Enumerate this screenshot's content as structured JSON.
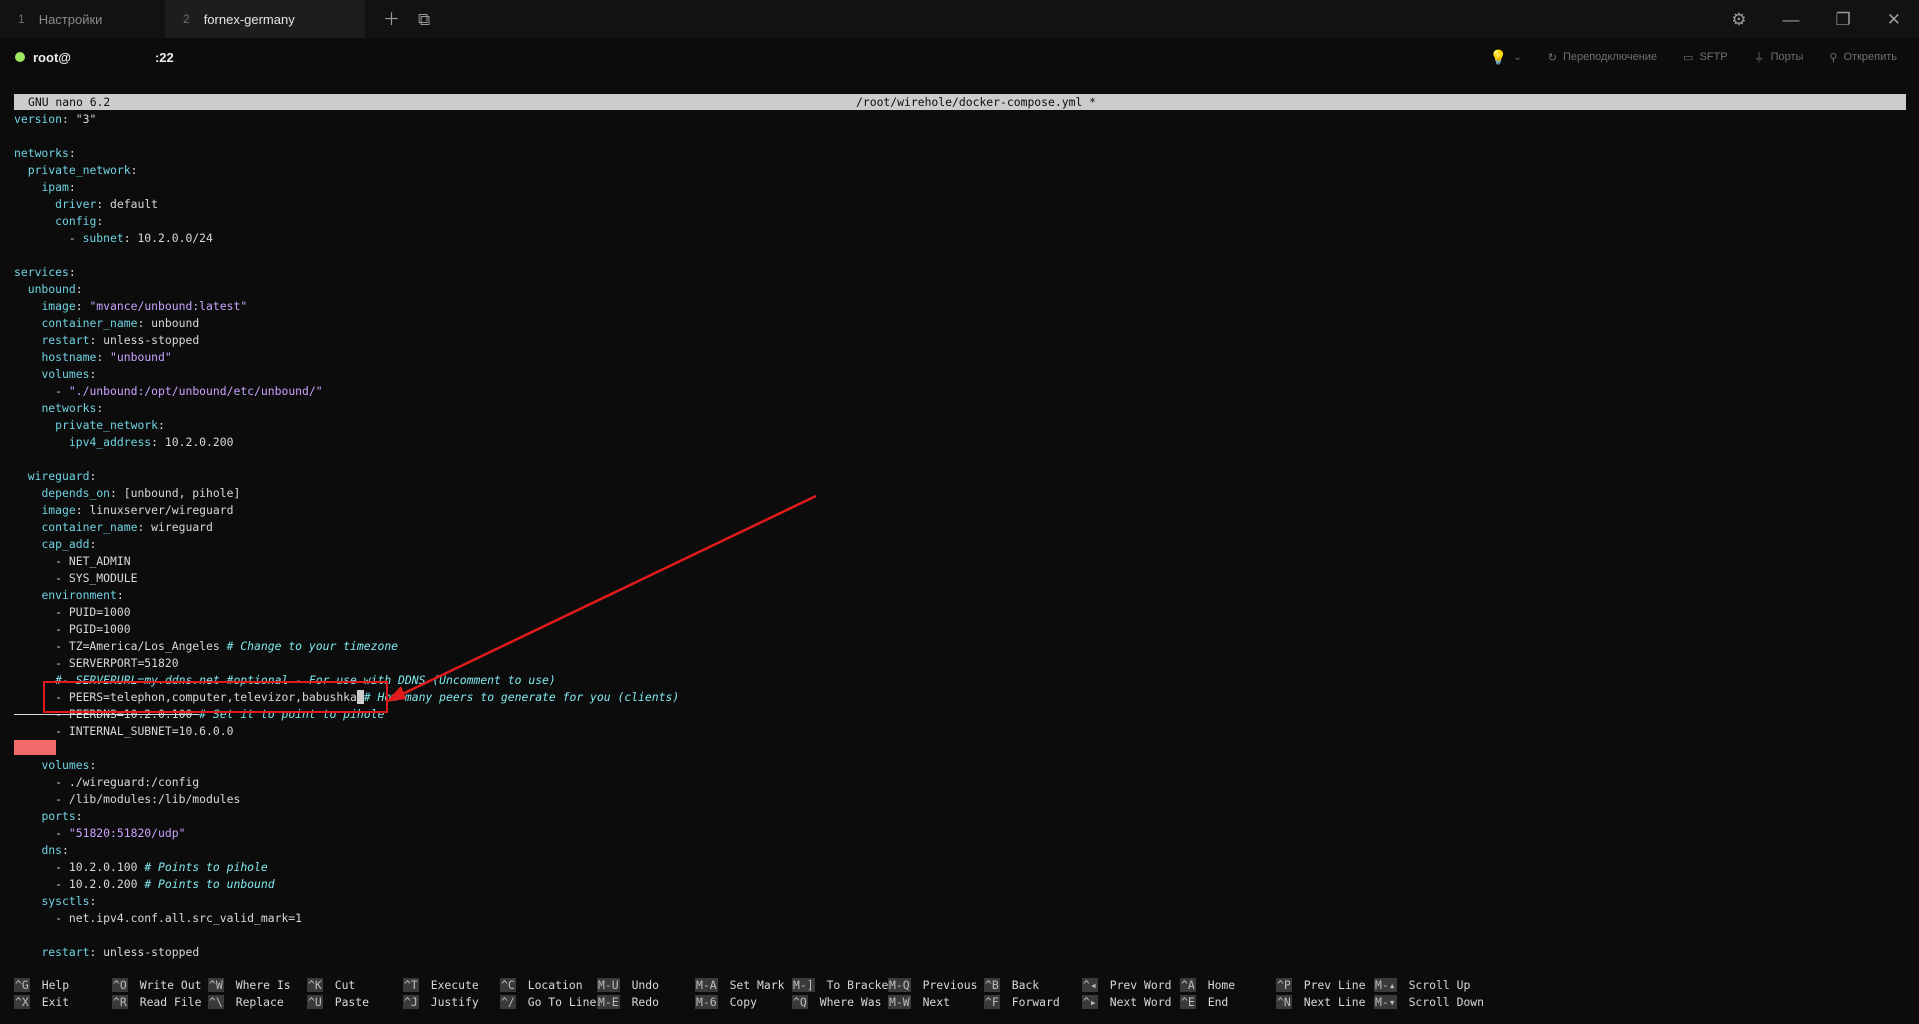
{
  "tabs": [
    {
      "num": "1",
      "label": "Настройки"
    },
    {
      "num": "2",
      "label": "fornex-germany"
    }
  ],
  "tab_actions": {
    "add_icon": "plus-icon",
    "window_icon": "copy-window-icon"
  },
  "window_controls": {
    "settings": "gear-icon",
    "minimize": "minimize-icon",
    "restore": "restore-icon",
    "close": "close-icon"
  },
  "session": {
    "user": "root@",
    "port": ":22",
    "status_color": "#9ee85f",
    "actions": [
      {
        "icon": "reconnect-icon",
        "label": "Переподключение"
      },
      {
        "icon": "sftp-icon",
        "label": "SFTP"
      },
      {
        "icon": "ports-icon",
        "label": "Порты"
      },
      {
        "icon": "pin-icon",
        "label": "Открепить"
      }
    ]
  },
  "editor": {
    "version": "GNU nano 6.2",
    "file": "/root/wirehole/docker-compose.yml *"
  },
  "annotation": {
    "color": "#e11b1b"
  },
  "lines": [
    [
      {
        "t": "k",
        "v": "version"
      },
      {
        "t": "v",
        "v": ": \"3\""
      }
    ],
    [],
    [
      {
        "t": "k",
        "v": "networks"
      },
      {
        "t": "v",
        "v": ":"
      }
    ],
    [
      {
        "t": "v",
        "v": "  "
      },
      {
        "t": "k",
        "v": "private_network"
      },
      {
        "t": "v",
        "v": ":"
      }
    ],
    [
      {
        "t": "v",
        "v": "    "
      },
      {
        "t": "k",
        "v": "ipam"
      },
      {
        "t": "v",
        "v": ":"
      }
    ],
    [
      {
        "t": "v",
        "v": "      "
      },
      {
        "t": "k",
        "v": "driver"
      },
      {
        "t": "v",
        "v": ": default"
      }
    ],
    [
      {
        "t": "v",
        "v": "      "
      },
      {
        "t": "k",
        "v": "config"
      },
      {
        "t": "v",
        "v": ":"
      }
    ],
    [
      {
        "t": "v",
        "v": "        - "
      },
      {
        "t": "k",
        "v": "subnet"
      },
      {
        "t": "v",
        "v": ": 10.2.0.0/24"
      }
    ],
    [],
    [
      {
        "t": "k",
        "v": "services"
      },
      {
        "t": "v",
        "v": ":"
      }
    ],
    [
      {
        "t": "v",
        "v": "  "
      },
      {
        "t": "k",
        "v": "unbound"
      },
      {
        "t": "v",
        "v": ":"
      }
    ],
    [
      {
        "t": "v",
        "v": "    "
      },
      {
        "t": "k",
        "v": "image"
      },
      {
        "t": "v",
        "v": ": "
      },
      {
        "t": "s",
        "v": "\"mvance/unbound:latest\""
      }
    ],
    [
      {
        "t": "v",
        "v": "    "
      },
      {
        "t": "k",
        "v": "container_name"
      },
      {
        "t": "v",
        "v": ": unbound"
      }
    ],
    [
      {
        "t": "v",
        "v": "    "
      },
      {
        "t": "k",
        "v": "restart"
      },
      {
        "t": "v",
        "v": ": unless-stopped"
      }
    ],
    [
      {
        "t": "v",
        "v": "    "
      },
      {
        "t": "k",
        "v": "hostname"
      },
      {
        "t": "v",
        "v": ": "
      },
      {
        "t": "s",
        "v": "\"unbound\""
      }
    ],
    [
      {
        "t": "v",
        "v": "    "
      },
      {
        "t": "k",
        "v": "volumes"
      },
      {
        "t": "v",
        "v": ":"
      }
    ],
    [
      {
        "t": "v",
        "v": "      - "
      },
      {
        "t": "s",
        "v": "\"./unbound:/opt/unbound/etc/unbound/\""
      }
    ],
    [
      {
        "t": "v",
        "v": "    "
      },
      {
        "t": "k",
        "v": "networks"
      },
      {
        "t": "v",
        "v": ":"
      }
    ],
    [
      {
        "t": "v",
        "v": "      "
      },
      {
        "t": "k",
        "v": "private_network"
      },
      {
        "t": "v",
        "v": ":"
      }
    ],
    [
      {
        "t": "v",
        "v": "        "
      },
      {
        "t": "k",
        "v": "ipv4_address"
      },
      {
        "t": "v",
        "v": ": 10.2.0.200"
      }
    ],
    [],
    [
      {
        "t": "v",
        "v": "  "
      },
      {
        "t": "k",
        "v": "wireguard"
      },
      {
        "t": "v",
        "v": ":"
      }
    ],
    [
      {
        "t": "v",
        "v": "    "
      },
      {
        "t": "k",
        "v": "depends_on"
      },
      {
        "t": "v",
        "v": ": [unbound, pihole]"
      }
    ],
    [
      {
        "t": "v",
        "v": "    "
      },
      {
        "t": "k",
        "v": "image"
      },
      {
        "t": "v",
        "v": ": linuxserver/wireguard"
      }
    ],
    [
      {
        "t": "v",
        "v": "    "
      },
      {
        "t": "k",
        "v": "container_name"
      },
      {
        "t": "v",
        "v": ": wireguard"
      }
    ],
    [
      {
        "t": "v",
        "v": "    "
      },
      {
        "t": "k",
        "v": "cap_add"
      },
      {
        "t": "v",
        "v": ":"
      }
    ],
    [
      {
        "t": "v",
        "v": "      - NET_ADMIN"
      }
    ],
    [
      {
        "t": "v",
        "v": "      - SYS_MODULE"
      }
    ],
    [
      {
        "t": "v",
        "v": "    "
      },
      {
        "t": "k",
        "v": "environment"
      },
      {
        "t": "v",
        "v": ":"
      }
    ],
    [
      {
        "t": "v",
        "v": "      - PUID=1000"
      }
    ],
    [
      {
        "t": "v",
        "v": "      - PGID=1000"
      }
    ],
    [
      {
        "t": "v",
        "v": "      - TZ=America/Los_Angeles "
      },
      {
        "t": "c",
        "v": "# Change to your timezone"
      }
    ],
    [
      {
        "t": "v",
        "v": "      - SERVERPORT=51820"
      }
    ],
    [
      {
        "t": "c",
        "v": "      #- SERVERURL=my.ddns.net #optional - For use with DDNS (Uncomment to use)"
      }
    ],
    [
      {
        "t": "v",
        "v": "      - PEERS=telephon,computer,televizor,babushka"
      },
      {
        "t": "cur",
        "v": " "
      },
      {
        "t": "c",
        "v": "# How many peers to generate for you (clients)"
      }
    ],
    [
      {
        "t": "strike",
        "v": "      - PEERDNS=10.2.0.100 "
      },
      {
        "t": "c",
        "v": "# Set it to point to pihole"
      }
    ],
    [
      {
        "t": "v",
        "v": "      - INTERNAL_SUBNET=10.6.0.0"
      }
    ],
    [],
    [
      {
        "t": "v",
        "v": "    "
      },
      {
        "t": "k",
        "v": "volumes"
      },
      {
        "t": "v",
        "v": ":"
      }
    ],
    [
      {
        "t": "v",
        "v": "      - ./wireguard:/config"
      }
    ],
    [
      {
        "t": "v",
        "v": "      - /lib/modules:/lib/modules"
      }
    ],
    [
      {
        "t": "v",
        "v": "    "
      },
      {
        "t": "k",
        "v": "ports"
      },
      {
        "t": "v",
        "v": ":"
      }
    ],
    [
      {
        "t": "v",
        "v": "      - "
      },
      {
        "t": "s",
        "v": "\"51820:51820/udp\""
      }
    ],
    [
      {
        "t": "v",
        "v": "    "
      },
      {
        "t": "k",
        "v": "dns"
      },
      {
        "t": "v",
        "v": ":"
      }
    ],
    [
      {
        "t": "v",
        "v": "      - 10.2.0.100 "
      },
      {
        "t": "c",
        "v": "# Points to pihole"
      }
    ],
    [
      {
        "t": "v",
        "v": "      - 10.2.0.200 "
      },
      {
        "t": "c",
        "v": "# Points to unbound"
      }
    ],
    [
      {
        "t": "v",
        "v": "    "
      },
      {
        "t": "k",
        "v": "sysctls"
      },
      {
        "t": "v",
        "v": ":"
      }
    ],
    [
      {
        "t": "v",
        "v": "      - net.ipv4.conf.all.src_valid_mark=1"
      }
    ],
    [],
    [
      {
        "t": "v",
        "v": "    "
      },
      {
        "t": "k",
        "v": "restart"
      },
      {
        "t": "v",
        "v": ": unless-stopped"
      }
    ]
  ],
  "shortcuts": [
    [
      {
        "key": "^G",
        "label": "Help"
      },
      {
        "key": "^X",
        "label": "Exit"
      }
    ],
    [
      {
        "key": "^O",
        "label": "Write Out"
      },
      {
        "key": "^R",
        "label": "Read File"
      }
    ],
    [
      {
        "key": "^W",
        "label": "Where Is"
      },
      {
        "key": "^\\",
        "label": "Replace"
      }
    ],
    [
      {
        "key": "^K",
        "label": "Cut"
      },
      {
        "key": "^U",
        "label": "Paste"
      }
    ],
    [
      {
        "key": "^T",
        "label": "Execute"
      },
      {
        "key": "^J",
        "label": "Justify"
      }
    ],
    [
      {
        "key": "^C",
        "label": "Location"
      },
      {
        "key": "^/",
        "label": "Go To Line"
      }
    ],
    [
      {
        "key": "M-U",
        "label": "Undo"
      },
      {
        "key": "M-E",
        "label": "Redo"
      }
    ],
    [
      {
        "key": "M-A",
        "label": "Set Mark"
      },
      {
        "key": "M-6",
        "label": "Copy"
      }
    ],
    [
      {
        "key": "M-]",
        "label": "To Bracket"
      },
      {
        "key": "^Q",
        "label": "Where Was"
      }
    ],
    [
      {
        "key": "M-Q",
        "label": "Previous"
      },
      {
        "key": "M-W",
        "label": "Next"
      }
    ],
    [
      {
        "key": "^B",
        "label": "Back"
      },
      {
        "key": "^F",
        "label": "Forward"
      }
    ],
    [
      {
        "key": "^◂",
        "label": "Prev Word"
      },
      {
        "key": "^▸",
        "label": "Next Word"
      }
    ],
    [
      {
        "key": "^A",
        "label": "Home"
      },
      {
        "key": "^E",
        "label": "End"
      }
    ],
    [
      {
        "key": "^P",
        "label": "Prev Line"
      },
      {
        "key": "^N",
        "label": "Next Line"
      }
    ],
    [
      {
        "key": "M-▴",
        "label": "Scroll Up"
      },
      {
        "key": "M-▾",
        "label": "Scroll Down"
      }
    ]
  ]
}
